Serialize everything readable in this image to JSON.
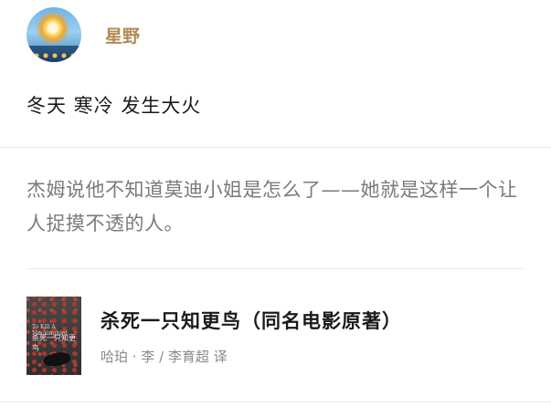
{
  "user": {
    "name": "星野",
    "avatar_icon": "avatar-sunflower-sky"
  },
  "post": {
    "text": "冬天 寒冷 发生大火"
  },
  "quote": {
    "text": "杰姆说他不知道莫迪小姐是怎么了——她就是这样一个让人捉摸不透的人。"
  },
  "book": {
    "title": "杀死一只知更鸟（同名电影原著）",
    "author": "哈珀 · 李 / 李育超 译",
    "cover": {
      "small_title_en": "To Kill A Mockingbird",
      "small_title_cn": "杀死一只知更鸟"
    }
  },
  "colors": {
    "username": "#b08a55",
    "quote_text": "#7a7a7a",
    "divider": "#ececec"
  }
}
